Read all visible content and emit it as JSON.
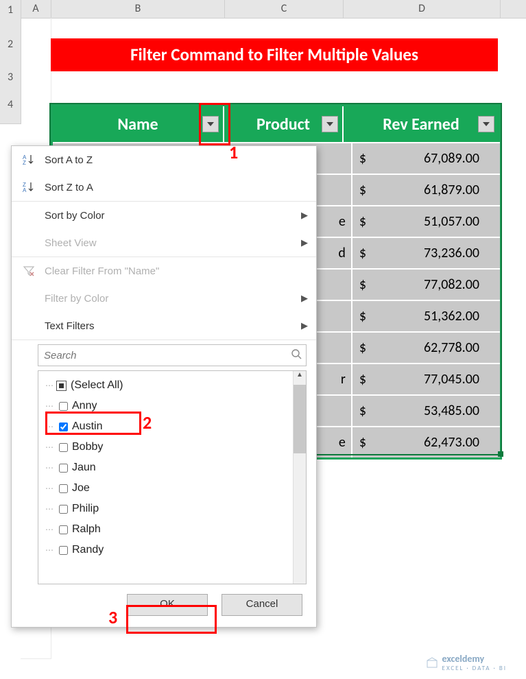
{
  "columns": {
    "A": "A",
    "B": "B",
    "C": "C",
    "D": "D"
  },
  "rows": {
    "r1": "1",
    "r2": "2",
    "r3": "3",
    "r4": "4"
  },
  "title": "Filter Command to Filter Multiple Values",
  "headers": {
    "name": "Name",
    "product": "Product",
    "rev": "Rev Earned"
  },
  "table": [
    {
      "product": "",
      "currency": "$",
      "rev": "67,089.00"
    },
    {
      "product": "",
      "currency": "$",
      "rev": "61,879.00"
    },
    {
      "product": "e",
      "currency": "$",
      "rev": "51,057.00"
    },
    {
      "product": "d",
      "currency": "$",
      "rev": "73,236.00"
    },
    {
      "product": "",
      "currency": "$",
      "rev": "77,082.00"
    },
    {
      "product": "",
      "currency": "$",
      "rev": "51,362.00"
    },
    {
      "product": "",
      "currency": "$",
      "rev": "62,778.00"
    },
    {
      "product": "r",
      "currency": "$",
      "rev": "77,045.00"
    },
    {
      "product": "",
      "currency": "$",
      "rev": "53,485.00"
    },
    {
      "product": "e",
      "currency": "$",
      "rev": "62,473.00"
    }
  ],
  "menu": {
    "sort_a_z": "Sort A to Z",
    "sort_z_a": "Sort Z to A",
    "sort_by_color": "Sort by Color",
    "sheet_view": "Sheet View",
    "clear_filter": "Clear Filter From \"Name\"",
    "filter_by_color": "Filter by Color",
    "text_filters": "Text Filters",
    "search_placeholder": "Search",
    "select_all": "(Select All)",
    "items": [
      "Anny",
      "Austin",
      "Bobby",
      "Jaun",
      "Joe",
      "Philip",
      "Ralph",
      "Randy"
    ],
    "ok": "OK",
    "cancel": "Cancel"
  },
  "annotations": {
    "label1": "1",
    "label2": "2",
    "label3": "3"
  },
  "watermark": {
    "brand": "exceldemy",
    "sub": "EXCEL · DATA · BI"
  }
}
